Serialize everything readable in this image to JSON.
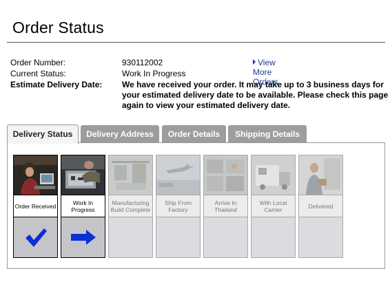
{
  "page": {
    "title": "Order Status"
  },
  "order": {
    "number_label": "Order Number:",
    "number": "930112002",
    "status_label": "Current Status:",
    "status": "Work In Progress",
    "estimate_label": "Estimate Delivery Date:",
    "estimate_note": "We have received your order. It may take up to 3 business days for your estimated delivery date to be available. Please check this page again to view your estimated delivery date.",
    "view_more": "View More Orders"
  },
  "tabs": [
    {
      "label": "Delivery Status",
      "active": true
    },
    {
      "label": "Delivery Address",
      "active": false
    },
    {
      "label": "Order Details",
      "active": false
    },
    {
      "label": "Shipping Details",
      "active": false
    }
  ],
  "steps": [
    {
      "label": "Order Received",
      "state": "done",
      "status_icon": "checkmark-icon"
    },
    {
      "label": "Work In Progress",
      "state": "current",
      "status_icon": "arrow-right-icon"
    },
    {
      "label": "Manufacturing Build Complete",
      "state": "pending",
      "status_icon": ""
    },
    {
      "label": "Ship From Factory",
      "state": "pending",
      "status_icon": ""
    },
    {
      "label": "Arrive In Thailand",
      "state": "pending",
      "status_icon": ""
    },
    {
      "label": "With Local Carrier",
      "state": "pending",
      "status_icon": ""
    },
    {
      "label": "Delivered",
      "state": "pending",
      "status_icon": ""
    }
  ],
  "colors": {
    "accent": "#1f3c9a",
    "tab_inactive": "#9d9d9d",
    "icon_blue": "#0a2fd6"
  }
}
